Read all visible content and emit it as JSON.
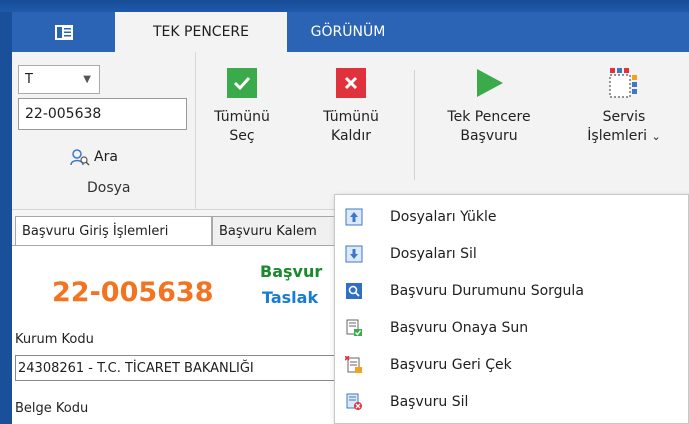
{
  "tabs": {
    "active": "TEK PENCERE",
    "second": "GÖRÜNÜM"
  },
  "dosya_group": {
    "combo_value": "T",
    "file_number": "22-005638",
    "search_label": "Ara",
    "group_label": "Dosya"
  },
  "ribbon_buttons": {
    "select_all_line1": "Tümünü",
    "select_all_line2": "Seç",
    "remove_all_line1": "Tümünü",
    "remove_all_line2": "Kaldır",
    "single_window_line1": "Tek Pencere",
    "single_window_line2": "Başvuru",
    "service_line1": "Servis",
    "service_line2": "İşlemleri"
  },
  "form": {
    "tab1": "Başvuru Giriş İşlemleri",
    "tab2": "Başvuru Kalem",
    "file_number": "22-005638",
    "status_line1": "Başvur",
    "status_line2": "Taslak",
    "kurum_kodu_label": "Kurum Kodu",
    "kurum_kodu_value": "24308261 - T.C. TİCARET BAKANLIĞI",
    "belge_kodu_label": "Belge Kodu"
  },
  "service_menu": {
    "items": [
      {
        "label": "Dosyaları Yükle",
        "icon": "upload-icon"
      },
      {
        "label": "Dosyaları Sil",
        "icon": "download-icon"
      },
      {
        "label": "Başvuru Durumunu Sorgula",
        "icon": "search-icon"
      },
      {
        "label": "Başvuru Onaya Sun",
        "icon": "approve-document-icon"
      },
      {
        "label": "Başvuru Geri Çek",
        "icon": "withdraw-document-icon"
      },
      {
        "label": "Başvuru Sil",
        "icon": "delete-document-icon"
      }
    ]
  },
  "colors": {
    "ribbon_blue": "#2b63b5",
    "file_number_orange": "#f47320",
    "status_green": "#1a8a2d",
    "status_blue": "#1a7cd0"
  }
}
